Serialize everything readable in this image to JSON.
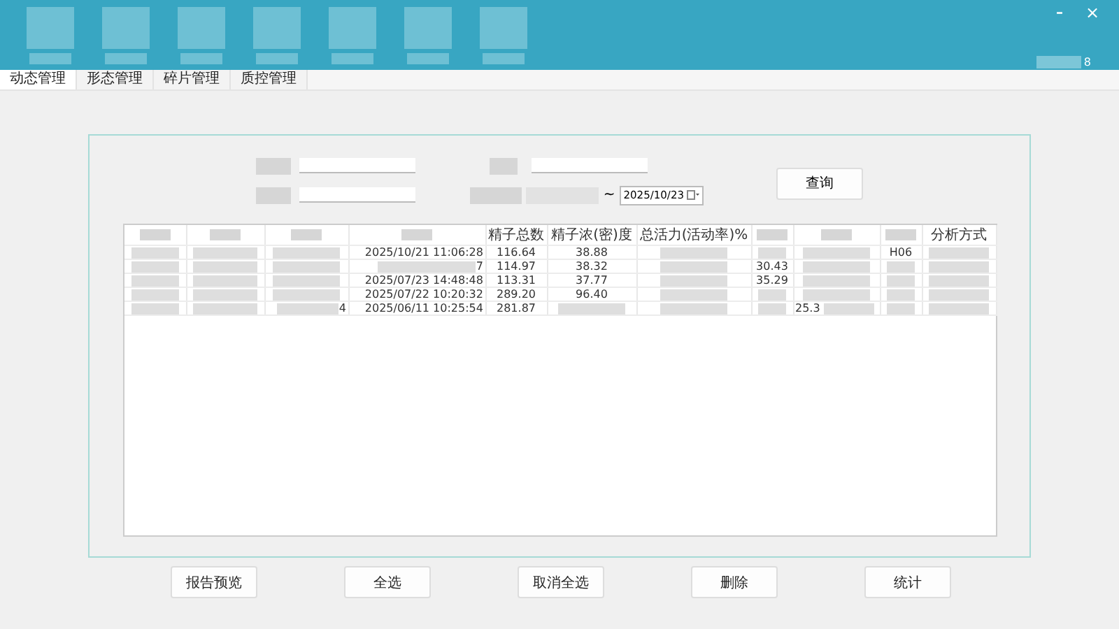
{
  "window": {
    "controls": [
      {
        "kind": "minimize",
        "text": "–"
      },
      {
        "kind": "close",
        "text": "×"
      }
    ],
    "toolbar": [
      {
        "redacted": true
      },
      {
        "redacted": true
      },
      {
        "redacted": true
      },
      {
        "redacted": true
      },
      {
        "redacted": true
      },
      {
        "redacted": true
      },
      {
        "redacted": true
      }
    ],
    "user": {
      "text": "8",
      "redacted": true
    }
  },
  "tabs": [
    {
      "label": "动态管理",
      "selected": true
    },
    {
      "label": "形态管理",
      "selected": false
    },
    {
      "label": "碎片管理",
      "selected": false
    },
    {
      "label": "质控管理",
      "selected": false
    }
  ],
  "filters": {
    "row_1": [
      {
        "label_redacted": true
      },
      {
        "label_redacted": true
      }
    ],
    "row_2_field": {
      "label_redacted": true
    },
    "date_range": {
      "label_redacted": true,
      "start_redacted": true,
      "separator": "~",
      "end": "2025/10/23"
    },
    "query_button": "查询"
  },
  "table": {
    "columns": [
      {
        "redacted": true
      },
      {
        "redacted": true
      },
      {
        "redacted": true
      },
      {
        "redacted": true
      },
      {
        "text": "精子总数"
      },
      {
        "text": "精子浓(密)度"
      },
      {
        "text": "总活力(活动率)%"
      },
      {
        "redacted": true
      },
      {
        "redacted": true
      },
      {
        "redacted": true
      },
      {
        "text": "分析方式"
      }
    ],
    "rows": [
      {
        "cells": [
          {
            "redacted": true
          },
          {
            "redacted": true
          },
          {
            "redacted": true
          },
          {
            "text": "2025/10/21 11:06:28"
          },
          {
            "text": "116.64"
          },
          {
            "text": "38.88"
          },
          {
            "redacted": true
          },
          {
            "redacted": true
          },
          {
            "redacted": true
          },
          {
            "text": "H06"
          },
          {
            "redacted": true
          }
        ]
      },
      {
        "cells": [
          {
            "redacted": true
          },
          {
            "redacted": true
          },
          {
            "redacted": true
          },
          {
            "text": "7",
            "redacted": true
          },
          {
            "text": "114.97"
          },
          {
            "text": "38.32"
          },
          {
            "redacted": true
          },
          {
            "text": "30.43"
          },
          {
            "redacted": true
          },
          {
            "redacted": true
          },
          {
            "redacted": true
          }
        ]
      },
      {
        "cells": [
          {
            "redacted": true
          },
          {
            "redacted": true
          },
          {
            "redacted": true
          },
          {
            "text": "2025/07/23 14:48:48"
          },
          {
            "text": "113.31"
          },
          {
            "text": "37.77"
          },
          {
            "redacted": true
          },
          {
            "text": "35.29"
          },
          {
            "redacted": true
          },
          {
            "redacted": true
          },
          {
            "redacted": true
          }
        ]
      },
      {
        "cells": [
          {
            "redacted": true
          },
          {
            "redacted": true
          },
          {
            "redacted": true
          },
          {
            "text": "2025/07/22 10:20:32"
          },
          {
            "text": "289.20"
          },
          {
            "text": "96.40"
          },
          {
            "redacted": true
          },
          {
            "redacted": true
          },
          {
            "redacted": true
          },
          {
            "redacted": true
          },
          {
            "redacted": true
          }
        ]
      },
      {
        "cells": [
          {
            "redacted": true
          },
          {
            "redacted": true
          },
          {
            "text": "4",
            "redacted": true
          },
          {
            "text": "2025/06/11 10:25:54"
          },
          {
            "text": "281.87"
          },
          {
            "redacted": true
          },
          {
            "redacted": true
          },
          {
            "redacted": true
          },
          {
            "text": "25.3",
            "redacted": true,
            "text_first": true
          },
          {
            "redacted": true
          },
          {
            "redacted": true
          }
        ]
      }
    ]
  },
  "buttons": [
    "报告预览",
    "全选",
    "取消全选",
    "删除",
    "统计"
  ]
}
